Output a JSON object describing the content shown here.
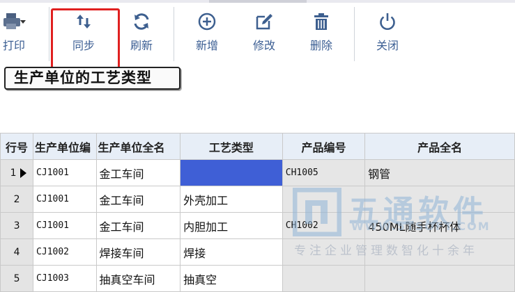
{
  "toolbar": {
    "print_label": "打印",
    "sync_label": "同步",
    "refresh_label": "刷新",
    "add_label": "新增",
    "edit_label": "修改",
    "delete_label": "删除",
    "close_label": "关闭",
    "highlight_color": "#e02020"
  },
  "page": {
    "title": "生产单位的工艺类型"
  },
  "table": {
    "headers": [
      "行号",
      "生产单位编",
      "生产单位全名",
      "工艺类型",
      "产品编号",
      "产品全名"
    ],
    "rows": [
      {
        "no": "1",
        "unit_code": "CJ1001",
        "unit_name": "金工车间",
        "process": "",
        "prod_code": "CH1005",
        "prod_name": "钢管"
      },
      {
        "no": "2",
        "unit_code": "CJ1001",
        "unit_name": "金工车间",
        "process": "外壳加工",
        "prod_code": "",
        "prod_name": ""
      },
      {
        "no": "3",
        "unit_code": "CJ1001",
        "unit_name": "金工车间",
        "process": "内胆加工",
        "prod_code": "CH1002",
        "prod_name": "450ML随手杯杯体"
      },
      {
        "no": "4",
        "unit_code": "CJ1002",
        "unit_name": "焊接车间",
        "process": "焊接",
        "prod_code": "",
        "prod_name": ""
      },
      {
        "no": "5",
        "unit_code": "CJ1003",
        "unit_name": "抽真空车间",
        "process": "抽真空",
        "prod_code": "",
        "prod_name": ""
      }
    ],
    "selected_color": "#3f5fd6"
  },
  "watermark": {
    "title": "五通软件",
    "url": "WWW.5TSOFT.COM",
    "slogan": "专注企业管理数智化十余年"
  }
}
